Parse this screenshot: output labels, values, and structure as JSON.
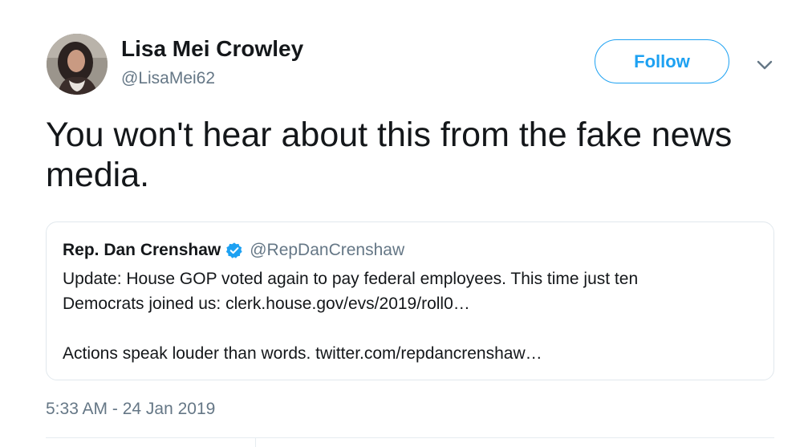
{
  "tweet": {
    "author": {
      "name": "Lisa Mei Crowley",
      "handle": "@LisaMei62"
    },
    "follow_label": "Follow",
    "text": "You won't hear about this from the fake news media.",
    "timestamp": "5:33 AM - 24 Jan 2019"
  },
  "quoted_tweet": {
    "author": {
      "name": "Rep. Dan Crenshaw",
      "handle": "@RepDanCrenshaw",
      "verified": true
    },
    "lines": [
      "Update: House GOP voted again to pay federal employees. This time just ten",
      "Democrats joined us: clerk.house.gov/evs/2019/roll0…"
    ],
    "second_paragraph": "Actions speak louder than words. twitter.com/repdancrenshaw…"
  },
  "icons": {
    "more": "chevron-down-icon",
    "verified": "verified-badge-icon"
  },
  "colors": {
    "accent": "#1da1f2",
    "text_primary": "#14171a",
    "text_secondary": "#657786",
    "border": "#e1e8ed"
  }
}
